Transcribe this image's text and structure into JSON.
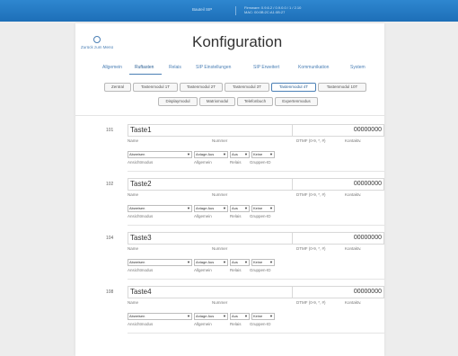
{
  "topbar": {
    "brand": "Bauteil SIP",
    "info_line1": "Firmware: 0.9.6.2 / 0.9.0.0 / 1 / 2.10",
    "info_line2": "MAC: 00:0B:2C:A1:0B:27"
  },
  "header": {
    "back_label": "Zurück zum Menü",
    "title": "Konfiguration"
  },
  "tabs": [
    "Allgemein",
    "Ruftasten",
    "Relais",
    "SIP Einstellungen",
    "SIP Erweitert",
    "Kommunikation",
    "System"
  ],
  "active_tab": "Ruftasten",
  "subtabs_row1": [
    "Zentral",
    "Tastenmodul 1T",
    "Tastenmodul 2T",
    "Tastenmodul 3T",
    "Tastenmodul 4T",
    "Tastenmodul 10T"
  ],
  "subtabs_row2": [
    "Displaymodul",
    "Matrixmodul",
    "Telefonbuch",
    "Expertenmodus"
  ],
  "active_subtab": "Tastenmodul 4T",
  "labels": {
    "name": "Name",
    "number": "Nummer",
    "dtmf": "DTMF (0-9, *, #)",
    "contact": "Kontaktv.",
    "ansicht": "Ansichtmodus",
    "allgemein": "Allgemein",
    "relais": "Relais",
    "gruppen": "Gruppen-ID"
  },
  "keys": [
    {
      "id": "101",
      "name": "Taste1",
      "number": "00000000",
      "ansicht": "Abweisen",
      "anlage": "Anlage Aus",
      "relais": "Aus",
      "gruppe": "Keine"
    },
    {
      "id": "102",
      "name": "Taste2",
      "number": "00000000",
      "ansicht": "Abweisen",
      "anlage": "Anlage Aus",
      "relais": "Aus",
      "gruppe": "Keine"
    },
    {
      "id": "104",
      "name": "Taste3",
      "number": "00000000",
      "ansicht": "Abweisen",
      "anlage": "Anlage Aus",
      "relais": "Aus",
      "gruppe": "Keine"
    },
    {
      "id": "108",
      "name": "Taste4",
      "number": "00000000",
      "ansicht": "Abweisen",
      "anlage": "Anlage Aus",
      "relais": "Aus",
      "gruppe": "Keine"
    }
  ],
  "colors": {
    "accent": "#4a7fb5",
    "topbar": "#1d6fb8"
  }
}
